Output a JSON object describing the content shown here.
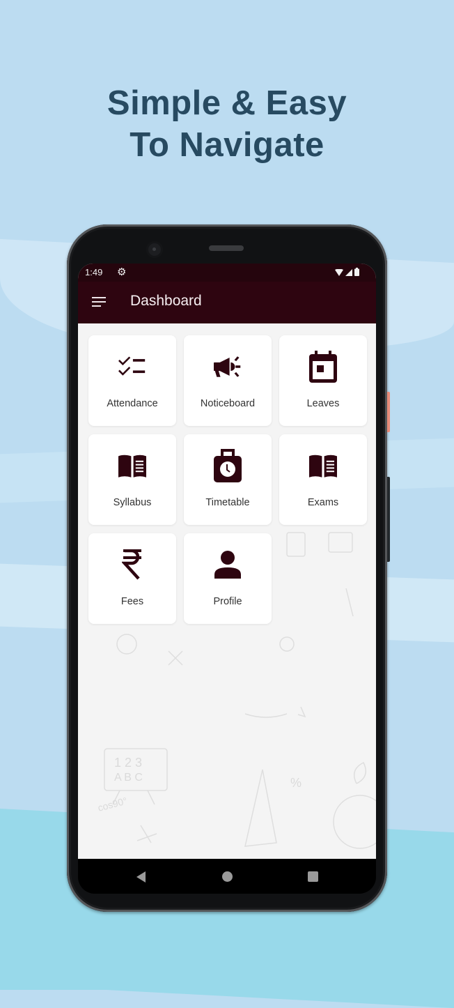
{
  "headline": {
    "line1": "Simple & Easy",
    "line2": "To Navigate"
  },
  "status_bar": {
    "time": "1:49",
    "left_icons": [
      "settings-gear-icon"
    ],
    "right_icons": [
      "wifi-icon",
      "cellular-signal-icon",
      "battery-icon"
    ]
  },
  "app_bar": {
    "menu_icon": "menu-icon",
    "title": "Dashboard"
  },
  "theme": {
    "primary": "#2e0510",
    "statusbar": "#25050d",
    "tile_bg": "#ffffff",
    "page_bg": "#bcdcf1",
    "headline_color": "#274a61"
  },
  "dashboard": {
    "tiles": [
      {
        "label": "Attendance",
        "icon": "checklist-icon"
      },
      {
        "label": "Noticeboard",
        "icon": "megaphone-icon"
      },
      {
        "label": "Leaves",
        "icon": "calendar-icon"
      },
      {
        "label": "Syllabus",
        "icon": "open-book-icon"
      },
      {
        "label": "Timetable",
        "icon": "clock-bag-icon"
      },
      {
        "label": "Exams",
        "icon": "open-book-icon"
      },
      {
        "label": "Fees",
        "icon": "rupee-icon"
      },
      {
        "label": "Profile",
        "icon": "person-icon"
      }
    ]
  },
  "nav_bar": {
    "buttons": [
      "back-icon",
      "home-icon",
      "recents-icon"
    ]
  }
}
